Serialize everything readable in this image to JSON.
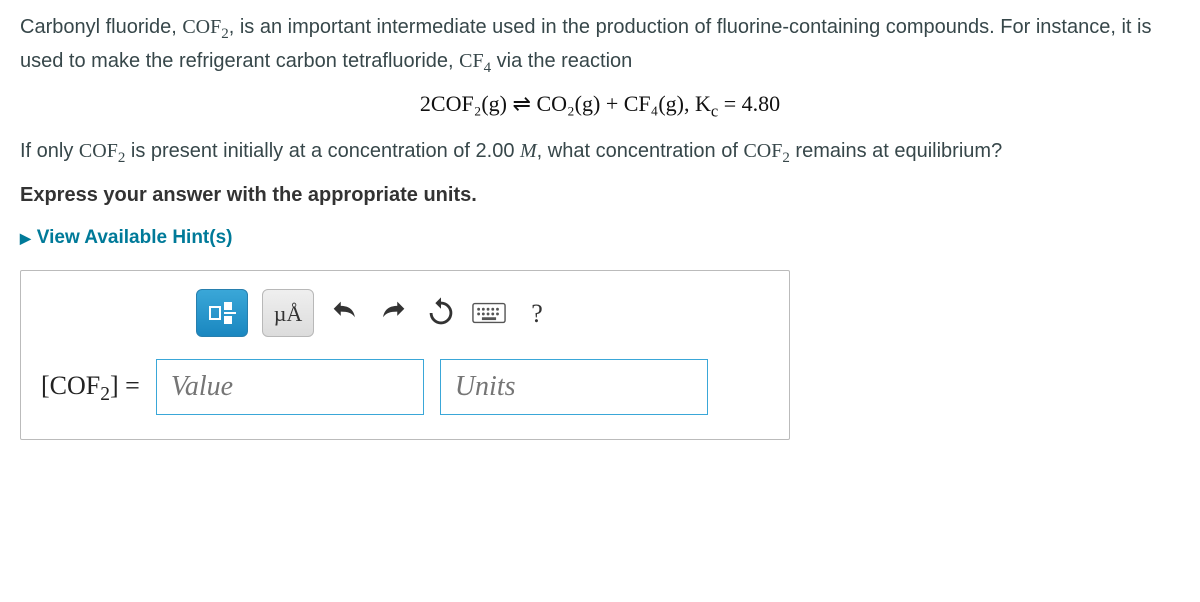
{
  "problem": {
    "intro_p1": "Carbonyl fluoride, ",
    "cof2": "COF",
    "sub2": "2",
    "intro_p2": ", is an important intermediate used in the production of fluorine-containing compounds. For instance, it is used to make the refrigerant carbon tetrafluoride, ",
    "cf4": "CF",
    "sub4": "4",
    "intro_p3": " via the reaction",
    "equation": "2COF₂(g) ⇌ CO₂(g) + CF₄(g),    K",
    "kc_sub": "c",
    "kc_val": " = 4.80",
    "q_p1": "If only ",
    "q_p2": " is present initially at a concentration of 2.00 ",
    "molar": "M",
    "q_p3": ", what concentration of ",
    "q_p4": " remains at equilibrium?",
    "instruction": "Express your answer with the appropriate units."
  },
  "hints_label": "View Available Hint(s)",
  "toolbar": {
    "mu_a": "µÅ",
    "question": "?"
  },
  "answer": {
    "lhs_open": "[COF",
    "lhs_sub": "2",
    "lhs_close": "] = ",
    "value_placeholder": "Value",
    "units_placeholder": "Units"
  }
}
